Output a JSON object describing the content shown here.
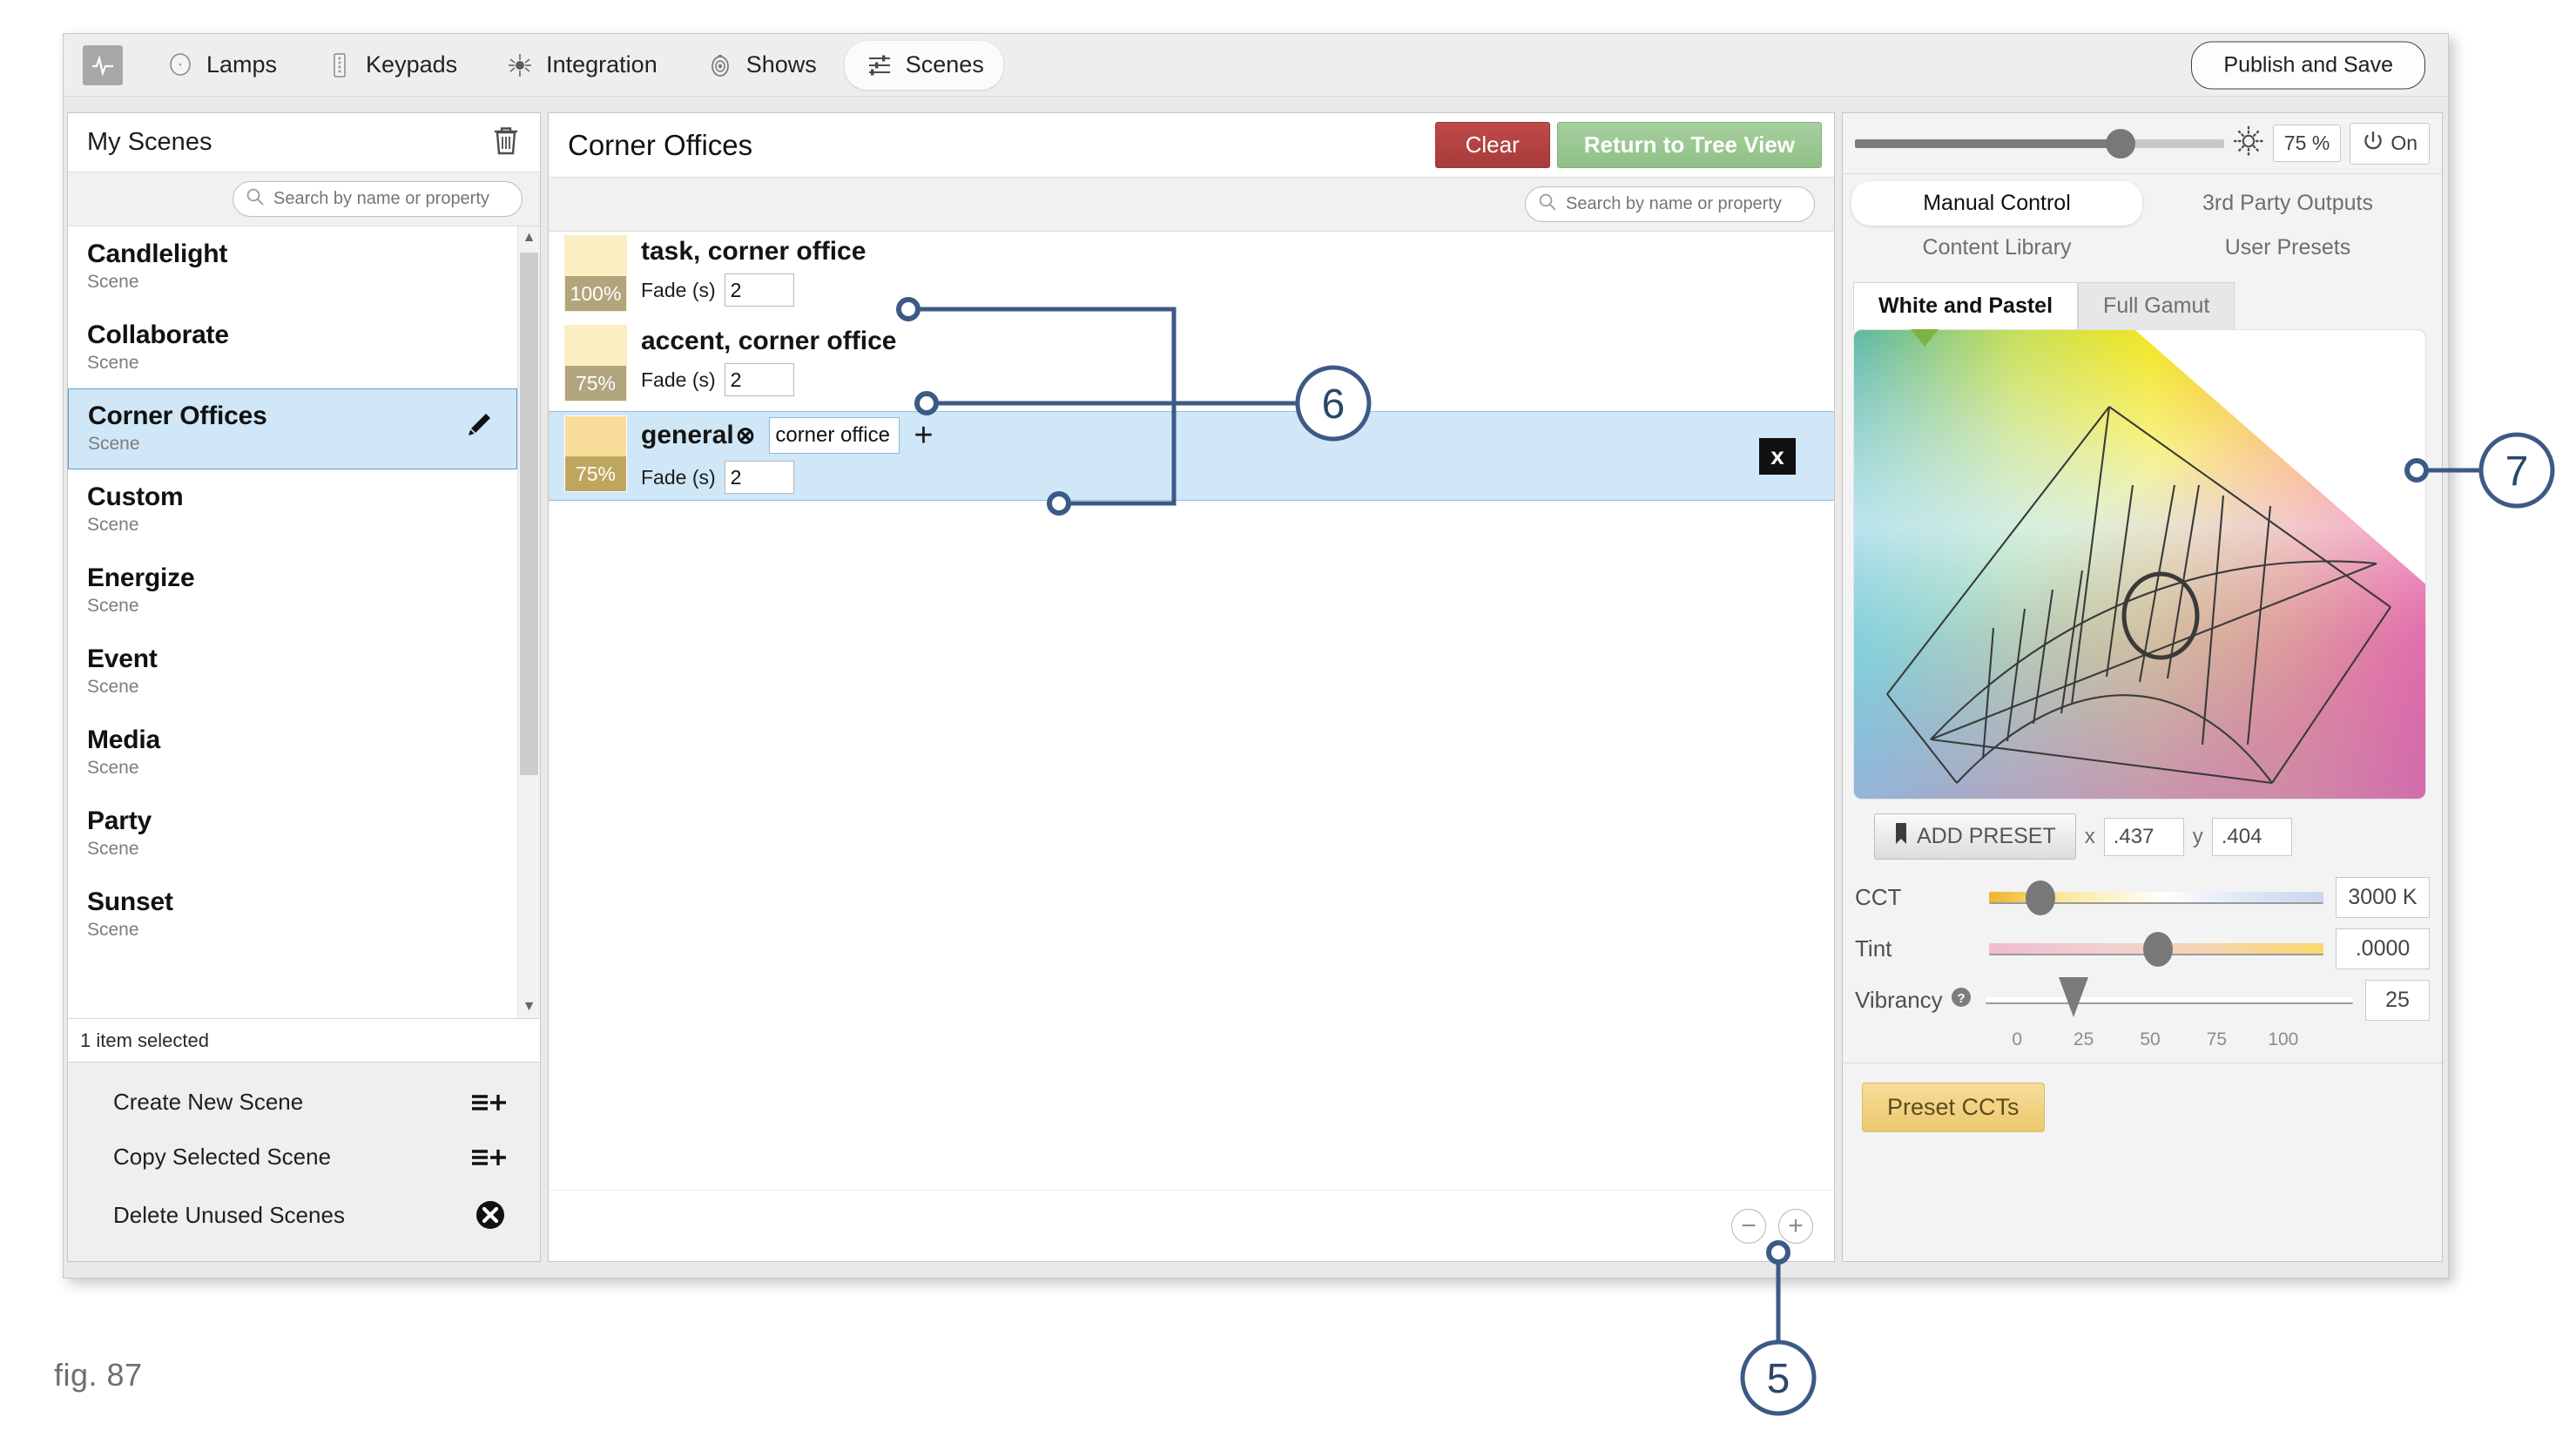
{
  "figure": {
    "label": "fig. 87"
  },
  "toolbar": {
    "logo_icon": "activity-pulse-icon",
    "items": [
      {
        "label": "Lamps",
        "icon": "lamp-icon",
        "active": false
      },
      {
        "label": "Keypads",
        "icon": "keypad-icon",
        "active": false
      },
      {
        "label": "Integration",
        "icon": "integration-icon",
        "active": false
      },
      {
        "label": "Shows",
        "icon": "shows-icon",
        "active": false
      },
      {
        "label": "Scenes",
        "icon": "sliders-icon",
        "active": true
      }
    ],
    "publish_label": "Publish and Save"
  },
  "sidebar": {
    "title": "My Scenes",
    "trash_icon": "trash-icon",
    "search": {
      "placeholder": "Search by name or property",
      "value": "",
      "icon": "search-icon"
    },
    "scenes": [
      {
        "name": "Candlelight",
        "type": "Scene",
        "selected": false
      },
      {
        "name": "Collaborate",
        "type": "Scene",
        "selected": false
      },
      {
        "name": "Corner Offices",
        "type": "Scene",
        "selected": true
      },
      {
        "name": "Custom",
        "type": "Scene",
        "selected": false
      },
      {
        "name": "Energize",
        "type": "Scene",
        "selected": false
      },
      {
        "name": "Event",
        "type": "Scene",
        "selected": false
      },
      {
        "name": "Media",
        "type": "Scene",
        "selected": false
      },
      {
        "name": "Party",
        "type": "Scene",
        "selected": false
      },
      {
        "name": "Sunset",
        "type": "Scene",
        "selected": false
      }
    ],
    "edit_icon": "pencil-icon",
    "status": "1 item selected",
    "actions": [
      {
        "label": "Create New Scene",
        "icon": "list-add-icon"
      },
      {
        "label": "Copy Selected Scene",
        "icon": "list-add-icon"
      },
      {
        "label": "Delete Unused Scenes",
        "icon": "delete-circle-icon"
      }
    ]
  },
  "center": {
    "title": "Corner Offices",
    "clear_label": "Clear",
    "return_label": "Return to Tree View",
    "search": {
      "placeholder": "Search by name or property",
      "value": "",
      "icon": "search-icon"
    },
    "fade_label": "Fade (s)",
    "rows": [
      {
        "name": "task, corner office",
        "percent": "100%",
        "fade": "2",
        "selected": false,
        "swatch_top": "#faeec2",
        "swatch_bottom": "#b0a57d",
        "editing": false
      },
      {
        "name": "accent, corner office",
        "percent": "75%",
        "fade": "2",
        "selected": false,
        "swatch_top": "#faeec2",
        "swatch_bottom": "#b0a57d",
        "editing": false
      },
      {
        "name": "general",
        "percent": "75%",
        "fade": "2",
        "selected": true,
        "swatch_top": "#f8dd9a",
        "swatch_bottom": "#bfa65e",
        "editing": true,
        "edit_value": "corner office",
        "remove_icon": "circle-x-icon",
        "add_icon": "plus-icon",
        "close_icon": "close-box-icon"
      }
    ],
    "zoom_out_icon": "zoom-out-icon",
    "zoom_in_icon": "zoom-in-icon"
  },
  "right_panel": {
    "brightness": {
      "percent": "75 %",
      "value": 75,
      "icon": "brightness-icon"
    },
    "power": {
      "label": "On",
      "icon": "power-icon"
    },
    "mode_tabs": [
      {
        "label": "Manual Control",
        "active": true
      },
      {
        "label": "3rd Party Outputs",
        "active": false
      },
      {
        "label": "Content Library",
        "active": false
      },
      {
        "label": "User Presets",
        "active": false
      }
    ],
    "gamut_tabs": [
      {
        "label": "White and Pastel",
        "active": true
      },
      {
        "label": "Full Gamut",
        "active": false
      }
    ],
    "add_preset": {
      "label": "ADD PRESET",
      "icon": "bookmark-icon"
    },
    "coords": {
      "x_label": "x",
      "x_value": ".437",
      "y_label": "y",
      "y_value": ".404"
    },
    "sliders": [
      {
        "name": "CCT",
        "value": "3000 K",
        "position": 13
      },
      {
        "name": "Tint",
        "value": ".0000",
        "position": 48
      },
      {
        "name": "Vibrancy",
        "value": "25",
        "position": 25,
        "help_icon": "help-icon"
      }
    ],
    "vibrancy_scale": [
      "0",
      "25",
      "50",
      "75",
      "100"
    ],
    "preset_ccts_label": "Preset CCTs"
  },
  "callouts": [
    {
      "number": "5"
    },
    {
      "number": "6"
    },
    {
      "number": "7"
    }
  ],
  "colors": {
    "accent_blue": "#3c5a86",
    "selection_blue": "#cfe7f7",
    "clear_red": "#b34040",
    "return_green": "#8fc086",
    "preset_gold": "#ecc96f"
  }
}
